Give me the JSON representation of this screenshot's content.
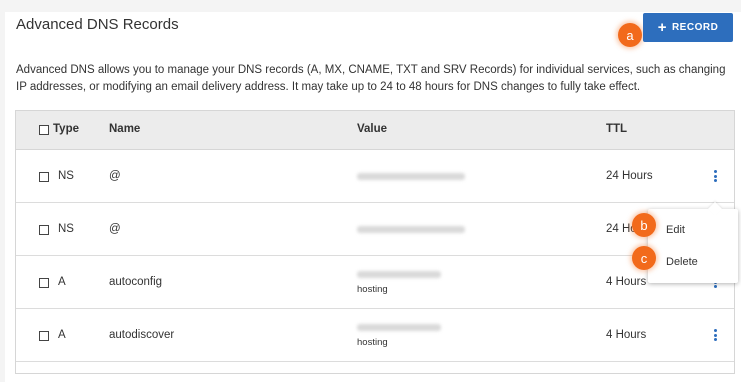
{
  "header": {
    "title": "Advanced DNS Records",
    "add_record_label": "RECORD",
    "description": "Advanced DNS allows you to manage your DNS records (A, MX, CNAME, TXT and SRV Records) for individual services, such as changing IP addresses, or modifying an email delivery address. It may take up to 24 to 48 hours for DNS changes to fully take effect."
  },
  "callouts": {
    "a": "a",
    "b": "b",
    "c": "c"
  },
  "table": {
    "columns": {
      "type": "Type",
      "name": "Name",
      "value": "Value",
      "ttl": "TTL"
    },
    "rows": [
      {
        "type": "NS",
        "name": "@",
        "value_sub": "",
        "ttl": "24 Hours"
      },
      {
        "type": "NS",
        "name": "@",
        "value_sub": "",
        "ttl": "24 Hours"
      },
      {
        "type": "A",
        "name": "autoconfig",
        "value_sub": "hosting",
        "ttl": "4 Hours"
      },
      {
        "type": "A",
        "name": "autodiscover",
        "value_sub": "hosting",
        "ttl": "4 Hours"
      }
    ]
  },
  "context_menu": {
    "edit": "Edit",
    "delete": "Delete"
  },
  "colors": {
    "accent": "#2d6ebd",
    "callout": "#f26a1b"
  }
}
